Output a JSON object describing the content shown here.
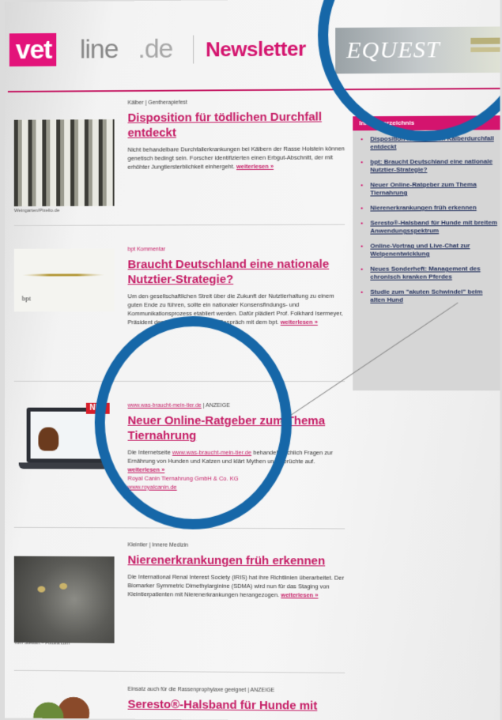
{
  "header": {
    "logo_vet": "vet",
    "logo_line": "line",
    "logo_de": ".de",
    "newsletter": "Newsletter",
    "sponsor": "EQUEST"
  },
  "articles": [
    {
      "kicker": "Kälber | Gentherapiefest",
      "title": "Disposition für tödlichen Durchfall entdeckt",
      "text": "Nicht behandelbare Durchfallerkrankungen bei Kälbern der Rasse Holstein können genetisch bedingt sein. Forscher identifizierten einen Erbgut-Abschnitt, der mit erhöhter Jungtiersterblichkeit einhergeht.",
      "more": "weiterlesen »",
      "image_caption": "Weingarten/Pixelio.de"
    },
    {
      "kicker": "bpt Kommentar",
      "title": "Braucht Deutschland eine nationale Nutztier-Strategie?",
      "text": "Um den gesellschaftlichen Streit über die Zukunft der Nutztierhaltung zu einem guten Ende zu führen, sollte ein nationaler Konsensfindungs- und Kommunikationsprozess etabliert werden. Dafür plädiert Prof. Folkhard Isermeyer, Präsident des Thünen-Instituts, im Gespräch mit dem bpt.",
      "more": "weiterlesen »",
      "image_text": "bpt"
    },
    {
      "kicker_link": "www.was-braucht-mein-tier.de",
      "kicker_suffix": " | ANZEIGE",
      "title": "Neuer Online-Ratgeber zum Thema Tiernahrung",
      "text_prefix": "Die Internetseite ",
      "text_link": "www.was-braucht-mein-tier.de",
      "text": " behandelt sachlich Fragen zur Ernährung von Hunden und Katzen und klärt Mythen und Gerüchte auf.",
      "more": "weiterlesen »",
      "sponsor_line": "Royal Canin Tiernahrung GmbH & Co. KG",
      "sponsor_link": "www.royalcanin.de",
      "badge": "NEU"
    },
    {
      "kicker": "Kleintier | Innere Medizin",
      "title": "Nierenerkrankungen früh erkennen",
      "text": "Die International Renal Interest Society (IRIS) hat ihre Richtlinien überarbeitet. Der Biomarker Symmetric Dimethylarginine (SDMA) wird nun für das Staging von Kleintierpatienten mit Nierenerkrankungen herangezogen.",
      "more": "weiterlesen »",
      "image_caption": "Tom Stewart – Fotolia.com"
    },
    {
      "kicker": "Einsatz auch für die Rassenprophylaxe geeignet | ANZEIGE",
      "title": "Seresto®-Halsband für Hunde mit"
    }
  ],
  "sidebar": {
    "title": "Inhaltsverzeichnis",
    "items": [
      "Disposition für tödlichen Kälberdurchfall entdeckt",
      "bpt: Braucht Deutschland eine nationale Nutztier-Strategie?",
      "Neuer Online-Ratgeber zum Thema Tiernahrung",
      "Nierenerkrankungen früh erkennen",
      "Seresto®-Halsband für Hunde mit breitem Anwendungsspektrum",
      "Online-Vortrag und Live-Chat zur Welpenentwicklung",
      "Neues Sonderheft: Management des chronisch kranken Pferdes",
      "Studie zum \"akuten Schwindel\" beim alten Hund"
    ]
  },
  "colors": {
    "accent": "#c51b64",
    "brand_pink": "#e3137a",
    "highlight_circle": "#1667a8"
  }
}
